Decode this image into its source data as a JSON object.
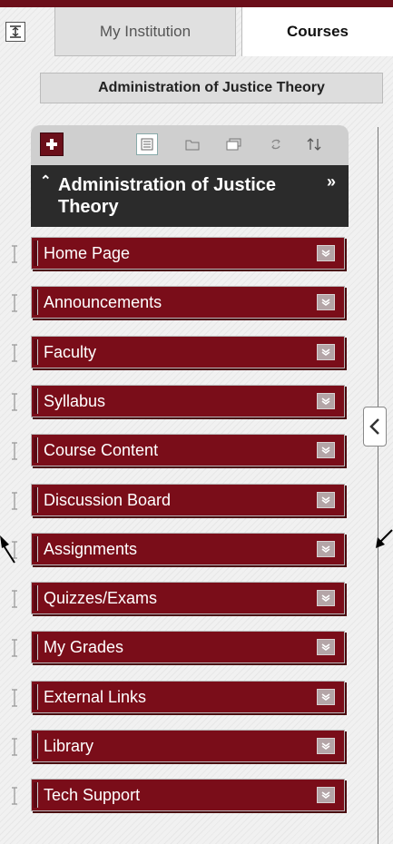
{
  "tabs": {
    "toggle_icon": "panel-toggle-icon",
    "items": [
      {
        "label": "My Institution",
        "active": false
      },
      {
        "label": "Courses",
        "active": true
      }
    ]
  },
  "course": {
    "title": "Administration of Justice Theory"
  },
  "course_menu": {
    "header_title": "Administration of Justice Theory",
    "toolbar_icons": [
      "add-menu-item-icon",
      "folder-view-icon",
      "list-view-icon",
      "open-window-icon",
      "refresh-icon",
      "reorder-icon"
    ],
    "items": [
      {
        "label": "Home Page"
      },
      {
        "label": "Announcements"
      },
      {
        "label": "Faculty"
      },
      {
        "label": "Syllabus"
      },
      {
        "label": "Course Content"
      },
      {
        "label": "Discussion Board"
      },
      {
        "label": "Assignments"
      },
      {
        "label": "Quizzes/Exams"
      },
      {
        "label": "My Grades"
      },
      {
        "label": "External Links"
      },
      {
        "label": "Library"
      },
      {
        "label": "Tech Support"
      }
    ]
  },
  "colors": {
    "brand": "#7a0d19",
    "header": "#2b2b2b"
  }
}
